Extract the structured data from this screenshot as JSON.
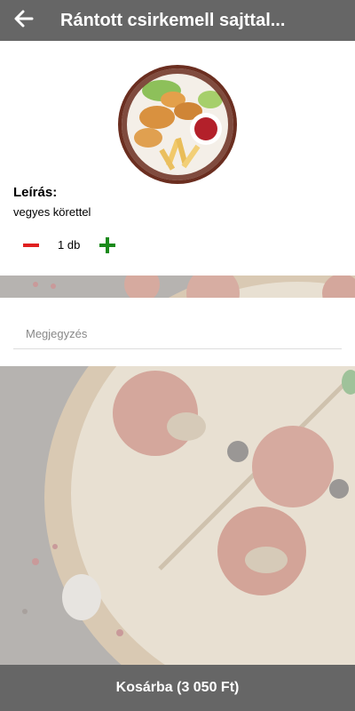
{
  "header": {
    "title": "Rántott csirkemell sajttal...",
    "back_icon": "arrow-left-icon"
  },
  "product": {
    "image_icon": "food-photo",
    "description_label": "Leírás:",
    "description": "vegyes körettel",
    "quantity_text": "1 db",
    "minus_color": "#e02020",
    "plus_color": "#1a8a1a"
  },
  "note": {
    "placeholder": "Megjegyzés",
    "value": ""
  },
  "footer": {
    "cart_label": "Kosárba (3 050 Ft)"
  },
  "colors": {
    "header_bg": "#666666",
    "footer_bg": "#666666"
  }
}
